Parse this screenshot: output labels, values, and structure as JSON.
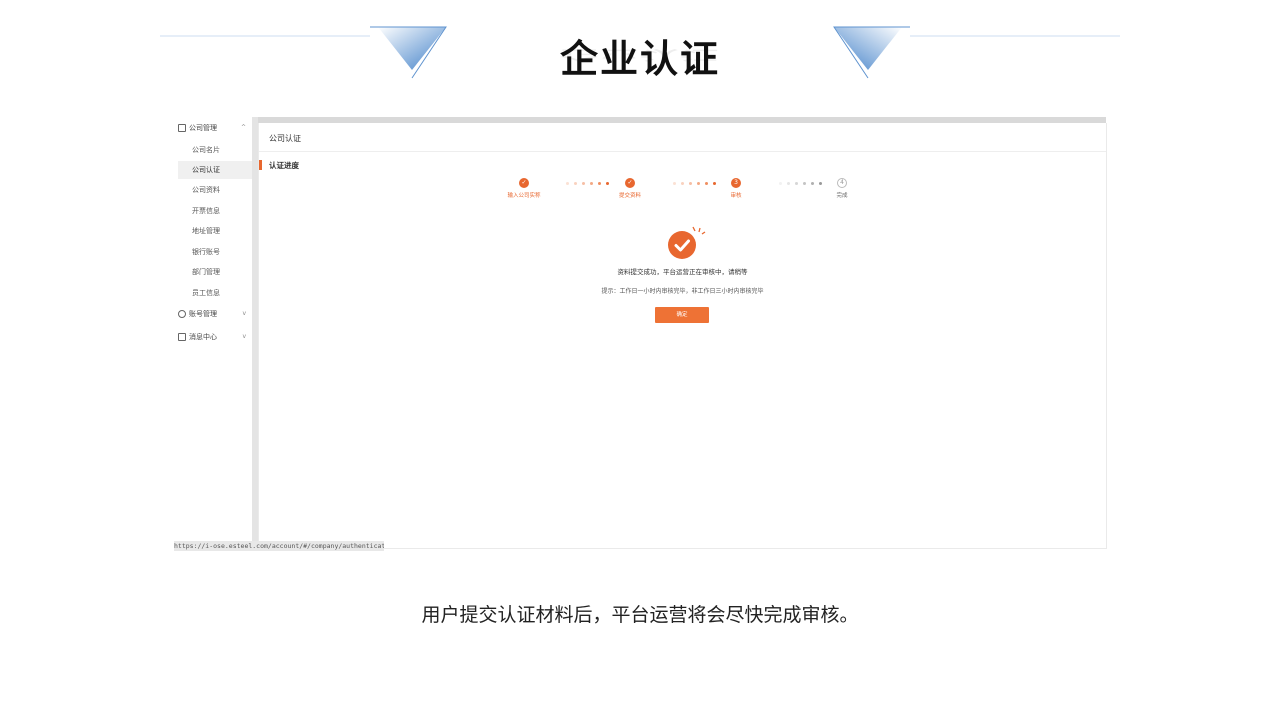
{
  "slide": {
    "title": "企业认证",
    "caption": "用户提交认证材料后，平台运营将会尽快完成审核。"
  },
  "sidebar": {
    "groups": [
      {
        "label": "公司管理",
        "chevron": "^"
      },
      {
        "label": "账号管理",
        "chevron": "v"
      },
      {
        "label": "消息中心",
        "chevron": "v"
      }
    ],
    "items": [
      {
        "label": "公司名片"
      },
      {
        "label": "公司认证",
        "active": true
      },
      {
        "label": "公司资料"
      },
      {
        "label": "开票信息"
      },
      {
        "label": "地址管理"
      },
      {
        "label": "银行账号"
      },
      {
        "label": "部门管理"
      },
      {
        "label": "员工信息"
      }
    ]
  },
  "content": {
    "page_title": "公司认证",
    "section_title": "认证进度",
    "steps": [
      {
        "label": "输入公司实称",
        "marker": "✓",
        "state": "done"
      },
      {
        "label": "提交资料",
        "marker": "✓",
        "state": "done"
      },
      {
        "label": "审核",
        "marker": "3",
        "state": "current"
      },
      {
        "label": "完成",
        "marker": "4",
        "state": "todo"
      }
    ],
    "success_message": "资料提交成功，平台运营正在审核中，请稍等",
    "tip": "提示：工作日一小时内审核完毕，非工作日三小时内审核完毕",
    "confirm_label": "确定"
  },
  "status_url": "https://i-ose.esteel.com/account/#/company/authenticate",
  "colors": {
    "accent": "#e8672f",
    "button": "#ee7235"
  }
}
